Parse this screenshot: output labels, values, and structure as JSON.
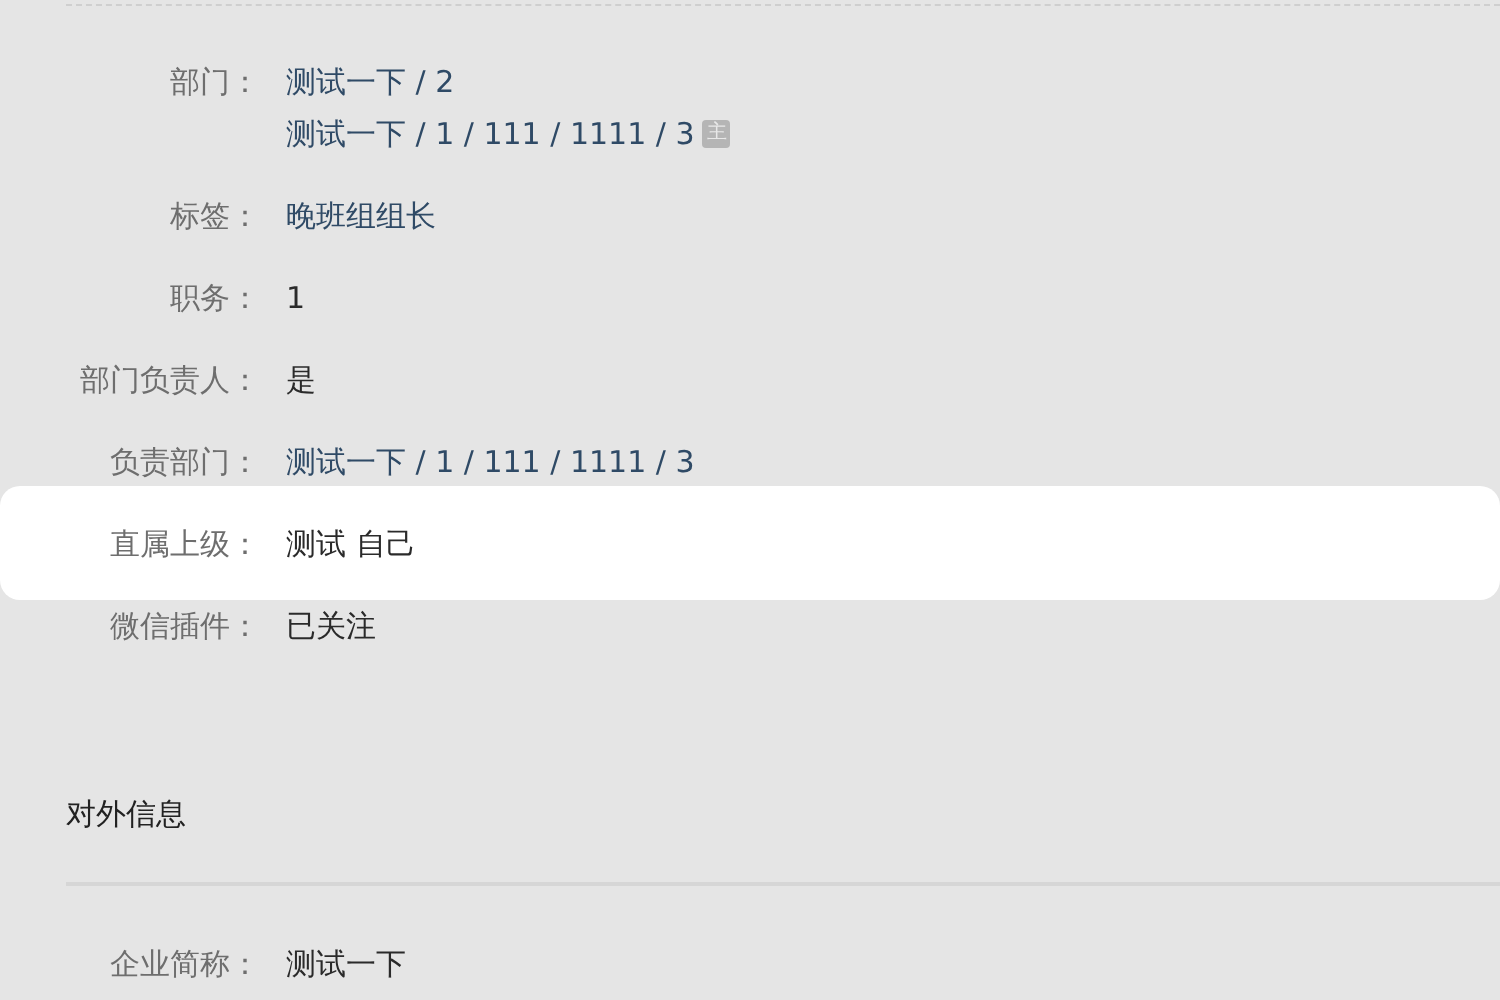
{
  "basic_info": {
    "rows": [
      {
        "label": "部门：",
        "highlighted": false,
        "lines": [
          {
            "text": "测试一下 / 2",
            "kind": "link"
          },
          {
            "text": "测试一下 / 1 / 111 / 1111 / 3",
            "kind": "link",
            "badge": "主"
          }
        ]
      },
      {
        "label": "标签：",
        "highlighted": false,
        "lines": [
          {
            "text": "晚班组组长",
            "kind": "link"
          }
        ]
      },
      {
        "label": "职务：",
        "highlighted": false,
        "lines": [
          {
            "text": "1",
            "kind": "text"
          }
        ]
      },
      {
        "label": "部门负责人：",
        "highlighted": false,
        "lines": [
          {
            "text": "是",
            "kind": "text"
          }
        ]
      },
      {
        "label": "负责部门：",
        "highlighted": false,
        "lines": [
          {
            "text": "测试一下 / 1 / 111 / 1111 / 3",
            "kind": "link"
          }
        ]
      },
      {
        "label": "直属上级：",
        "highlighted": true,
        "lines": [
          {
            "text": "测试 自己",
            "kind": "text"
          }
        ]
      },
      {
        "label": "微信插件：",
        "highlighted": false,
        "lines": [
          {
            "text": "已关注",
            "kind": "text"
          }
        ]
      }
    ]
  },
  "external_info": {
    "title": "对外信息",
    "rows": [
      {
        "label": "企业简称：",
        "highlighted": false,
        "lines": [
          {
            "text": "测试一下",
            "kind": "text"
          }
        ]
      }
    ]
  }
}
